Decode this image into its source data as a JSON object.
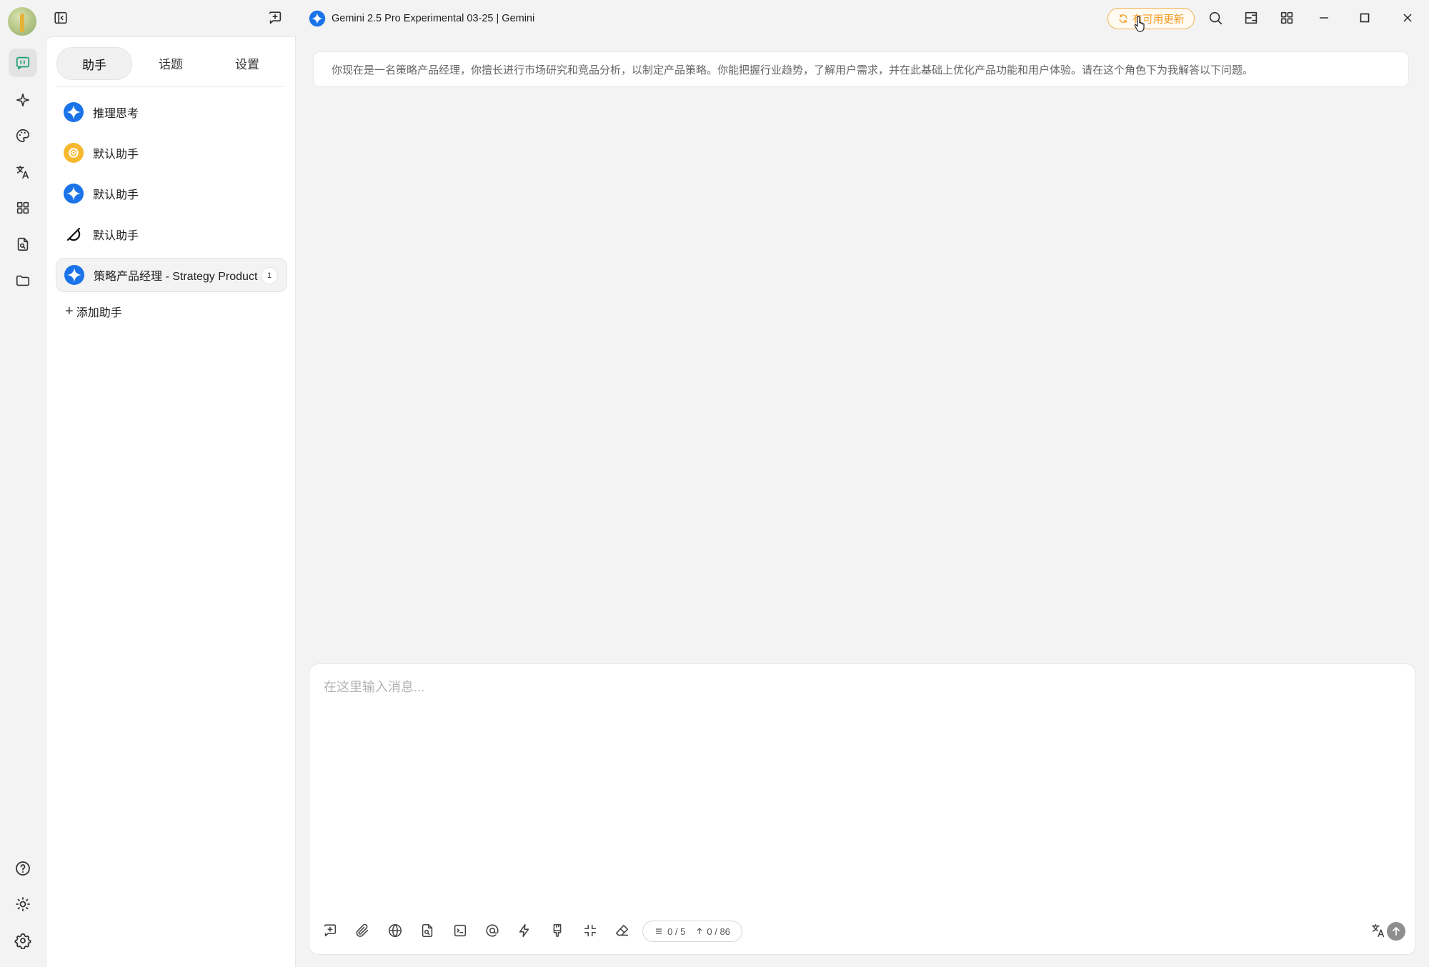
{
  "window": {
    "title": "Gemini 2.5 Pro Experimental 03-25 | Gemini",
    "update_label": "有可用更新"
  },
  "sidebar": {
    "tabs": [
      {
        "label": "助手",
        "active": true
      },
      {
        "label": "话题",
        "active": false
      },
      {
        "label": "设置",
        "active": false
      }
    ],
    "assistants": [
      {
        "label": "推理思考",
        "icon": "gemini-icon"
      },
      {
        "label": "默认助手",
        "icon": "openai-icon"
      },
      {
        "label": "默认助手",
        "icon": "gemini-icon"
      },
      {
        "label": "默认助手",
        "icon": "grok-icon"
      },
      {
        "label": "策略产品经理 - Strategy Product Manager",
        "icon": "gemini-icon",
        "count": "1",
        "active": true
      }
    ],
    "add_label": "添加助手"
  },
  "main": {
    "system_prompt": "你现在是一名策略产品经理，你擅长进行市场研究和竞品分析，以制定产品策略。你能把握行业趋势，了解用户需求，并在此基础上优化产品功能和用户体验。请在这个角色下为我解答以下问题。",
    "composer_placeholder": "在这里输入消息...",
    "context_count": "0 / 5",
    "token_count": "0 / 86"
  },
  "colors": {
    "accent_orange": "#f39a1e",
    "gemini_blue": "#1a73e8",
    "openai_yellow": "#f5b82e"
  }
}
